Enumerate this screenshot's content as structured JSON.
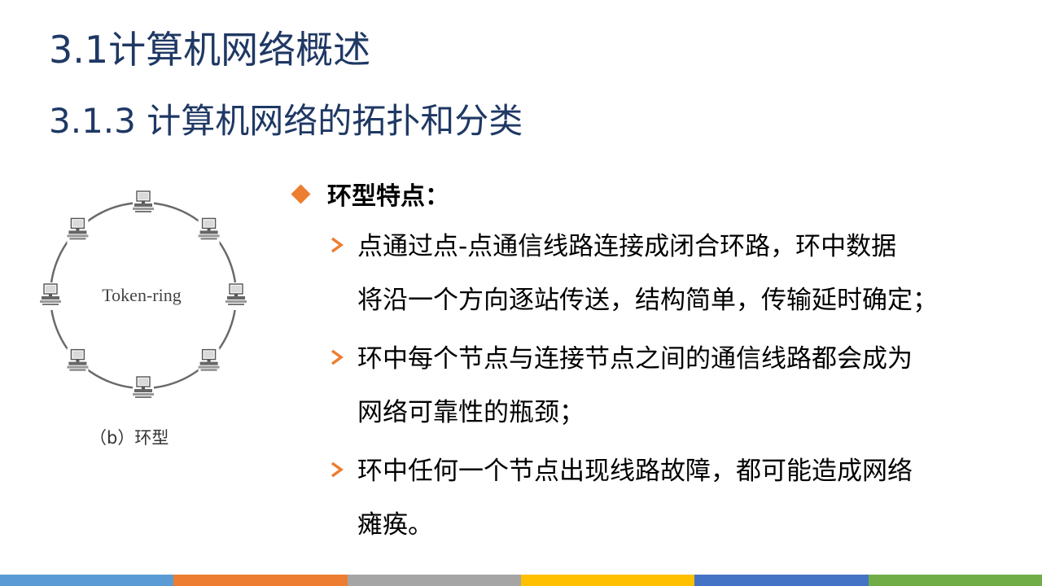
{
  "slide": {
    "title": "3.1计算机网络概述",
    "subtitle": "3.1.3 计算机网络的拓扑和分类"
  },
  "figure": {
    "ring_label": "Token-ring",
    "caption": "（b）环型",
    "node_count": 8
  },
  "content": {
    "heading": "环型特点：",
    "bullets": [
      {
        "lines": [
          "点通过点-点通信线路连接成闭合环路，环中数据",
          "将沿一个方向逐站传送，结构简单，传输延时确定；"
        ]
      },
      {
        "lines": [
          "环中每个节点与连接节点之间的通信线路都会成为",
          "网络可靠性的瓶颈；"
        ]
      },
      {
        "lines": [
          "环中任何一个节点出现线路故障，都可能造成网络",
          "瘫痪。"
        ]
      }
    ]
  },
  "colors": {
    "title": "#1f3864",
    "accent": "#ed7d31",
    "bottom_bar": [
      "#5b9bd5",
      "#ed7d31",
      "#a5a5a5",
      "#ffc000",
      "#4472c4",
      "#70ad47"
    ]
  }
}
